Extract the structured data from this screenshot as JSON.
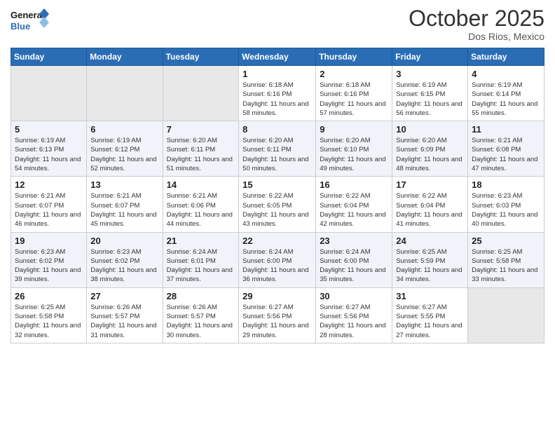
{
  "logo": {
    "text_general": "General",
    "text_blue": "Blue"
  },
  "header": {
    "month": "October 2025",
    "location": "Dos Rios, Mexico"
  },
  "weekdays": [
    "Sunday",
    "Monday",
    "Tuesday",
    "Wednesday",
    "Thursday",
    "Friday",
    "Saturday"
  ],
  "weeks": [
    [
      {
        "day": "",
        "empty": true
      },
      {
        "day": "",
        "empty": true
      },
      {
        "day": "",
        "empty": true
      },
      {
        "day": "1",
        "sunrise": "6:18 AM",
        "sunset": "6:16 PM",
        "daylight": "11 hours and 58 minutes."
      },
      {
        "day": "2",
        "sunrise": "6:18 AM",
        "sunset": "6:16 PM",
        "daylight": "11 hours and 57 minutes."
      },
      {
        "day": "3",
        "sunrise": "6:19 AM",
        "sunset": "6:15 PM",
        "daylight": "11 hours and 56 minutes."
      },
      {
        "day": "4",
        "sunrise": "6:19 AM",
        "sunset": "6:14 PM",
        "daylight": "11 hours and 55 minutes."
      }
    ],
    [
      {
        "day": "5",
        "sunrise": "6:19 AM",
        "sunset": "6:13 PM",
        "daylight": "11 hours and 54 minutes."
      },
      {
        "day": "6",
        "sunrise": "6:19 AM",
        "sunset": "6:12 PM",
        "daylight": "11 hours and 52 minutes."
      },
      {
        "day": "7",
        "sunrise": "6:20 AM",
        "sunset": "6:11 PM",
        "daylight": "11 hours and 51 minutes."
      },
      {
        "day": "8",
        "sunrise": "6:20 AM",
        "sunset": "6:11 PM",
        "daylight": "11 hours and 50 minutes."
      },
      {
        "day": "9",
        "sunrise": "6:20 AM",
        "sunset": "6:10 PM",
        "daylight": "11 hours and 49 minutes."
      },
      {
        "day": "10",
        "sunrise": "6:20 AM",
        "sunset": "6:09 PM",
        "daylight": "11 hours and 48 minutes."
      },
      {
        "day": "11",
        "sunrise": "6:21 AM",
        "sunset": "6:08 PM",
        "daylight": "11 hours and 47 minutes."
      }
    ],
    [
      {
        "day": "12",
        "sunrise": "6:21 AM",
        "sunset": "6:07 PM",
        "daylight": "11 hours and 46 minutes."
      },
      {
        "day": "13",
        "sunrise": "6:21 AM",
        "sunset": "6:07 PM",
        "daylight": "11 hours and 45 minutes."
      },
      {
        "day": "14",
        "sunrise": "6:21 AM",
        "sunset": "6:06 PM",
        "daylight": "11 hours and 44 minutes."
      },
      {
        "day": "15",
        "sunrise": "6:22 AM",
        "sunset": "6:05 PM",
        "daylight": "11 hours and 43 minutes."
      },
      {
        "day": "16",
        "sunrise": "6:22 AM",
        "sunset": "6:04 PM",
        "daylight": "11 hours and 42 minutes."
      },
      {
        "day": "17",
        "sunrise": "6:22 AM",
        "sunset": "6:04 PM",
        "daylight": "11 hours and 41 minutes."
      },
      {
        "day": "18",
        "sunrise": "6:23 AM",
        "sunset": "6:03 PM",
        "daylight": "11 hours and 40 minutes."
      }
    ],
    [
      {
        "day": "19",
        "sunrise": "6:23 AM",
        "sunset": "6:02 PM",
        "daylight": "11 hours and 39 minutes."
      },
      {
        "day": "20",
        "sunrise": "6:23 AM",
        "sunset": "6:02 PM",
        "daylight": "11 hours and 38 minutes."
      },
      {
        "day": "21",
        "sunrise": "6:24 AM",
        "sunset": "6:01 PM",
        "daylight": "11 hours and 37 minutes."
      },
      {
        "day": "22",
        "sunrise": "6:24 AM",
        "sunset": "6:00 PM",
        "daylight": "11 hours and 36 minutes."
      },
      {
        "day": "23",
        "sunrise": "6:24 AM",
        "sunset": "6:00 PM",
        "daylight": "11 hours and 35 minutes."
      },
      {
        "day": "24",
        "sunrise": "6:25 AM",
        "sunset": "5:59 PM",
        "daylight": "11 hours and 34 minutes."
      },
      {
        "day": "25",
        "sunrise": "6:25 AM",
        "sunset": "5:58 PM",
        "daylight": "11 hours and 33 minutes."
      }
    ],
    [
      {
        "day": "26",
        "sunrise": "6:25 AM",
        "sunset": "5:58 PM",
        "daylight": "11 hours and 32 minutes."
      },
      {
        "day": "27",
        "sunrise": "6:26 AM",
        "sunset": "5:57 PM",
        "daylight": "11 hours and 31 minutes."
      },
      {
        "day": "28",
        "sunrise": "6:26 AM",
        "sunset": "5:57 PM",
        "daylight": "11 hours and 30 minutes."
      },
      {
        "day": "29",
        "sunrise": "6:27 AM",
        "sunset": "5:56 PM",
        "daylight": "11 hours and 29 minutes."
      },
      {
        "day": "30",
        "sunrise": "6:27 AM",
        "sunset": "5:56 PM",
        "daylight": "11 hours and 28 minutes."
      },
      {
        "day": "31",
        "sunrise": "6:27 AM",
        "sunset": "5:55 PM",
        "daylight": "11 hours and 27 minutes."
      },
      {
        "day": "",
        "empty": true
      }
    ]
  ],
  "labels": {
    "sunrise": "Sunrise:",
    "sunset": "Sunset:",
    "daylight": "Daylight:"
  }
}
